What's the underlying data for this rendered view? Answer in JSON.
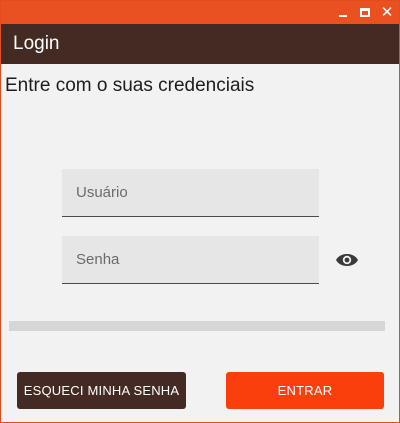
{
  "window": {
    "controls": {
      "minimize": "minimize-icon",
      "maximize": "maximize-icon",
      "close": "close-icon",
      "close_glyph": "✕"
    }
  },
  "app_bar": {
    "title": "Login"
  },
  "subtitle": "Entre com o suas credenciais",
  "form": {
    "username": {
      "placeholder": "Usuário",
      "value": ""
    },
    "password": {
      "placeholder": "Senha",
      "value": ""
    },
    "visibility_icon": "eye-icon"
  },
  "progress": {
    "value": 0
  },
  "buttons": {
    "forgot_label": "ESQUECI MINHA SENHA",
    "enter_label": "ENTRAR"
  },
  "colors": {
    "title_bar": "#ea5120",
    "app_bar": "#432a23",
    "primary_button": "#fb3f0c",
    "secondary_button": "#432a23"
  }
}
